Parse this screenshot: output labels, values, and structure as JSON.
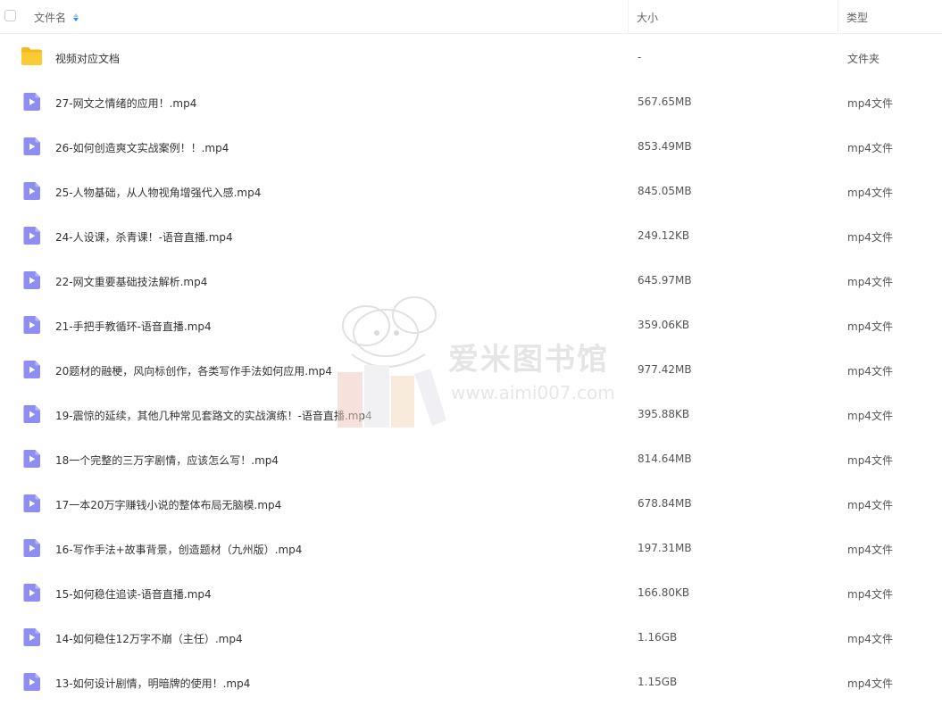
{
  "header": {
    "name_label": "文件名",
    "size_label": "大小",
    "type_label": "类型"
  },
  "watermark": {
    "title": "爱米图书馆",
    "url": "www.aimi007.com"
  },
  "files": [
    {
      "name": "视频对应文档",
      "size": "-",
      "type": "文件夹",
      "icon": "folder-icon"
    },
    {
      "name": "27-网文之情绪的应用！.mp4",
      "size": "567.65MB",
      "type": "mp4文件",
      "icon": "video-file-icon"
    },
    {
      "name": "26-如何创造爽文实战案例！！.mp4",
      "size": "853.49MB",
      "type": "mp4文件",
      "icon": "video-file-icon"
    },
    {
      "name": "25-人物基础，从人物视角增强代入感.mp4",
      "size": "845.05MB",
      "type": "mp4文件",
      "icon": "video-file-icon"
    },
    {
      "name": "24-人设课，杀青课！-语音直播.mp4",
      "size": "249.12KB",
      "type": "mp4文件",
      "icon": "video-file-icon"
    },
    {
      "name": "22-网文重要基础技法解析.mp4",
      "size": "645.97MB",
      "type": "mp4文件",
      "icon": "video-file-icon"
    },
    {
      "name": "21-手把手教循环-语音直播.mp4",
      "size": "359.06KB",
      "type": "mp4文件",
      "icon": "video-file-icon"
    },
    {
      "name": "20题材的融梗，风向标创作，各类写作手法如何应用.mp4",
      "size": "977.42MB",
      "type": "mp4文件",
      "icon": "video-file-icon"
    },
    {
      "name": "19-震惊的延续，其他几种常见套路文的实战演练！-语音直播.mp4",
      "size": "395.88KB",
      "type": "mp4文件",
      "icon": "video-file-icon"
    },
    {
      "name": "18一个完整的三万字剧情，应该怎么写！.mp4",
      "size": "814.64MB",
      "type": "mp4文件",
      "icon": "video-file-icon"
    },
    {
      "name": "17一本20万字赚钱小说的整体布局无脑模.mp4",
      "size": "678.84MB",
      "type": "mp4文件",
      "icon": "video-file-icon"
    },
    {
      "name": "16-写作手法+故事背景，创造题材（九州版）.mp4",
      "size": "197.31MB",
      "type": "mp4文件",
      "icon": "video-file-icon"
    },
    {
      "name": "15-如何稳住追读-语音直播.mp4",
      "size": "166.80KB",
      "type": "mp4文件",
      "icon": "video-file-icon"
    },
    {
      "name": "14-如何稳住12万字不崩（主任）.mp4",
      "size": "1.16GB",
      "type": "mp4文件",
      "icon": "video-file-icon"
    },
    {
      "name": "13-如何设计剧情，明暗牌的使用！.mp4",
      "size": "1.15GB",
      "type": "mp4文件",
      "icon": "video-file-icon"
    }
  ]
}
